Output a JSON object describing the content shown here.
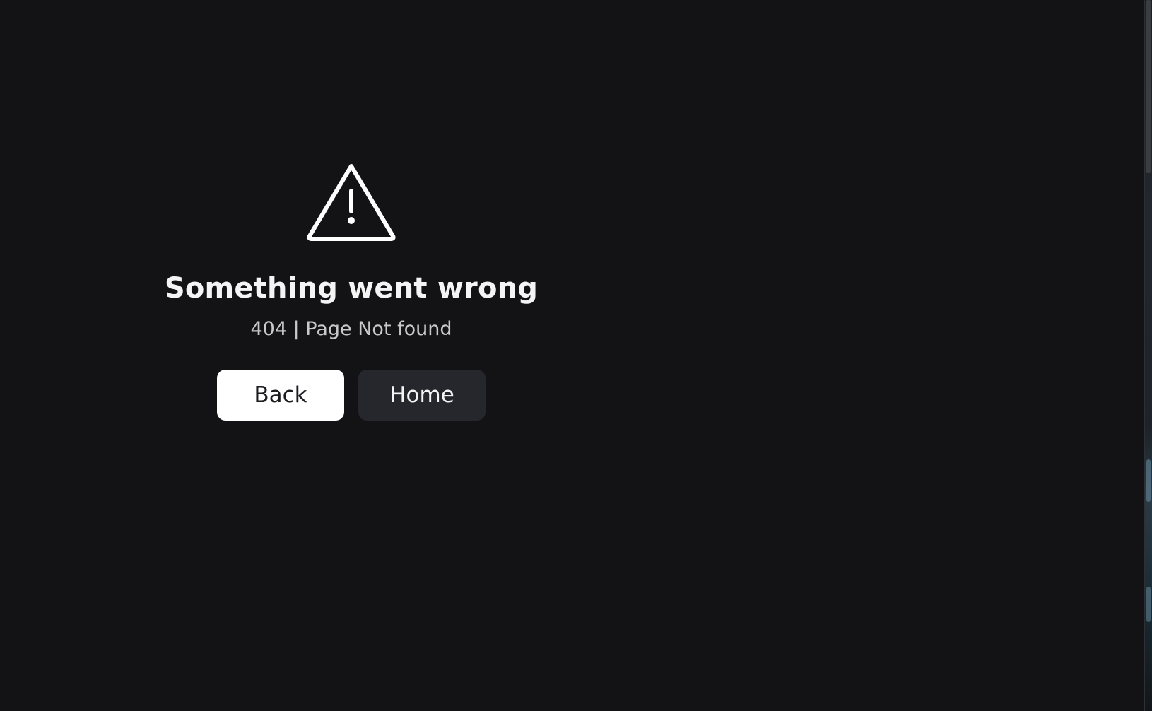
{
  "error": {
    "icon": "warning-triangle-icon",
    "title": "Something went wrong",
    "subtitle": "404 | Page Not found"
  },
  "actions": {
    "back_label": "Back",
    "home_label": "Home"
  },
  "colors": {
    "background": "#131315",
    "text_primary": "#f4f4f5",
    "text_secondary": "#c9c9cc",
    "back_button_bg": "#ffffff",
    "home_button_bg": "#26272d"
  }
}
